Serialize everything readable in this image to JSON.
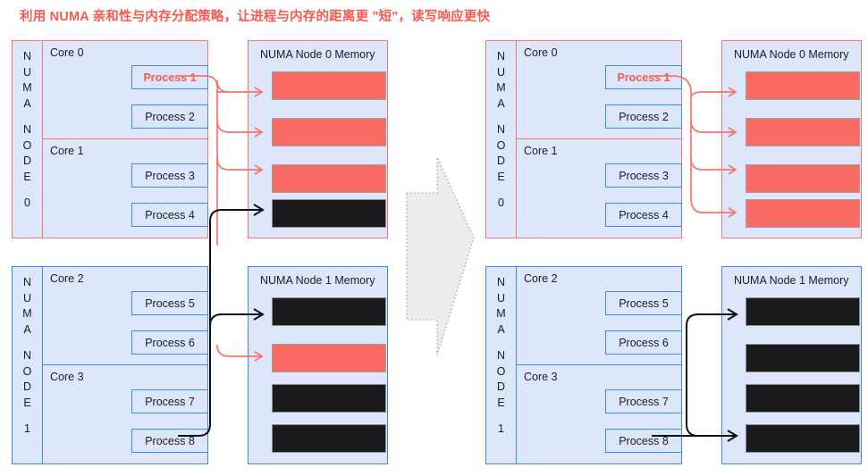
{
  "title": "利用 NUMA 亲和性与内存分配策略，让进程与内存的距离更 \"短\"，读写响应更快",
  "colors": {
    "accent_red": "#f8594f",
    "border_red": "#f8736b",
    "border_blue": "#3f87f5",
    "panel_bg": "#dde6fb",
    "memory_used": "#fa6b63",
    "memory_free": "#1b1b1d",
    "big_arrow_fill": "#ececec"
  },
  "big_arrow": {
    "name": "transformation-arrow",
    "direction": "right"
  },
  "left": {
    "node0": {
      "side_label_lines": [
        "N",
        "U",
        "M",
        "A",
        "N",
        "O",
        "D",
        "E",
        "0"
      ],
      "side_label_text": "NUMA NODE 0",
      "cores": [
        {
          "label": "Core 0",
          "processes": [
            {
              "label": "Process 1",
              "highlighted": true
            },
            {
              "label": "Process 2",
              "highlighted": false
            }
          ]
        },
        {
          "label": "Core 1",
          "processes": [
            {
              "label": "Process 3",
              "highlighted": false
            },
            {
              "label": "Process 4",
              "highlighted": false
            }
          ]
        }
      ]
    },
    "node1": {
      "side_label_lines": [
        "N",
        "U",
        "M",
        "A",
        "N",
        "O",
        "D",
        "E",
        "1"
      ],
      "side_label_text": "NUMA NODE 1",
      "cores": [
        {
          "label": "Core 2",
          "processes": [
            {
              "label": "Process 5",
              "highlighted": false
            },
            {
              "label": "Process 6",
              "highlighted": false
            }
          ]
        },
        {
          "label": "Core 3",
          "processes": [
            {
              "label": "Process 7",
              "highlighted": false
            },
            {
              "label": "Process 8",
              "highlighted": false
            }
          ]
        }
      ]
    },
    "mem0": {
      "title": "NUMA Node 0 Memory",
      "blocks": [
        "used",
        "used",
        "used",
        "free"
      ]
    },
    "mem1": {
      "title": "NUMA Node 1 Memory",
      "blocks": [
        "free",
        "used",
        "free",
        "free"
      ]
    }
  },
  "right": {
    "node0": {
      "side_label_lines": [
        "N",
        "U",
        "M",
        "A",
        "N",
        "O",
        "D",
        "E",
        "0"
      ],
      "side_label_text": "NUMA NODE 0",
      "cores": [
        {
          "label": "Core 0",
          "processes": [
            {
              "label": "Process 1",
              "highlighted": true
            },
            {
              "label": "Process 2",
              "highlighted": false
            }
          ]
        },
        {
          "label": "Core 1",
          "processes": [
            {
              "label": "Process 3",
              "highlighted": false
            },
            {
              "label": "Process 4",
              "highlighted": false
            }
          ]
        }
      ]
    },
    "node1": {
      "side_label_lines": [
        "N",
        "U",
        "M",
        "A",
        "N",
        "O",
        "D",
        "E",
        "1"
      ],
      "side_label_text": "NUMA NODE 1",
      "cores": [
        {
          "label": "Core 2",
          "processes": [
            {
              "label": "Process 5",
              "highlighted": false
            },
            {
              "label": "Process 6",
              "highlighted": false
            }
          ]
        },
        {
          "label": "Core 3",
          "processes": [
            {
              "label": "Process 7",
              "highlighted": false
            },
            {
              "label": "Process 8",
              "highlighted": false
            }
          ]
        }
      ]
    },
    "mem0": {
      "title": "NUMA Node 0 Memory",
      "blocks": [
        "used",
        "used",
        "used",
        "used"
      ]
    },
    "mem1": {
      "title": "NUMA Node 1 Memory",
      "blocks": [
        "free",
        "free",
        "free",
        "free"
      ]
    }
  }
}
